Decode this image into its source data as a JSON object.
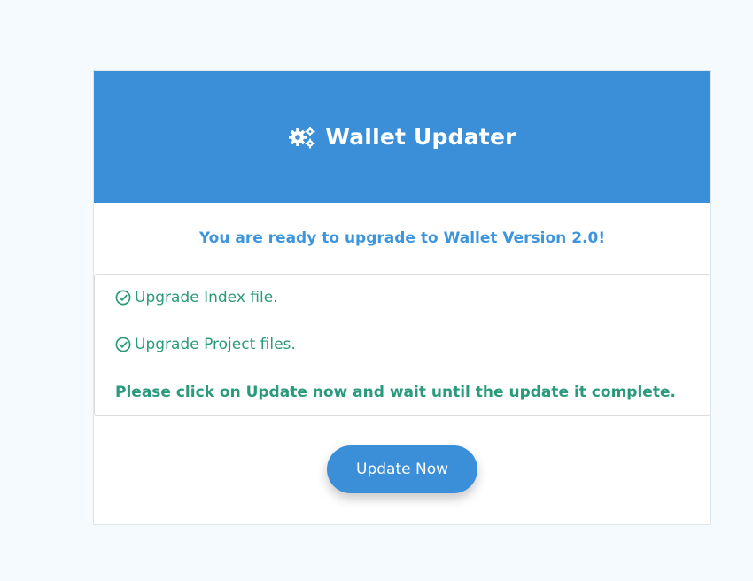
{
  "header": {
    "title": "Wallet Updater",
    "icon": "gears-icon"
  },
  "subtitle": "You are ready to upgrade to Wallet Version 2.0!",
  "steps": [
    {
      "label": "Upgrade Index file.",
      "icon": "check-circle-icon"
    },
    {
      "label": "Upgrade Project files.",
      "icon": "check-circle-icon"
    }
  ],
  "notice": "Please click on Update now and wait until the update it complete.",
  "update_button": {
    "label": "Update Now"
  },
  "colors": {
    "accent": "#3b8fd9",
    "success_text": "#2a9a7d",
    "subtitle": "#3d95de",
    "page_background": "#f4fafd"
  }
}
